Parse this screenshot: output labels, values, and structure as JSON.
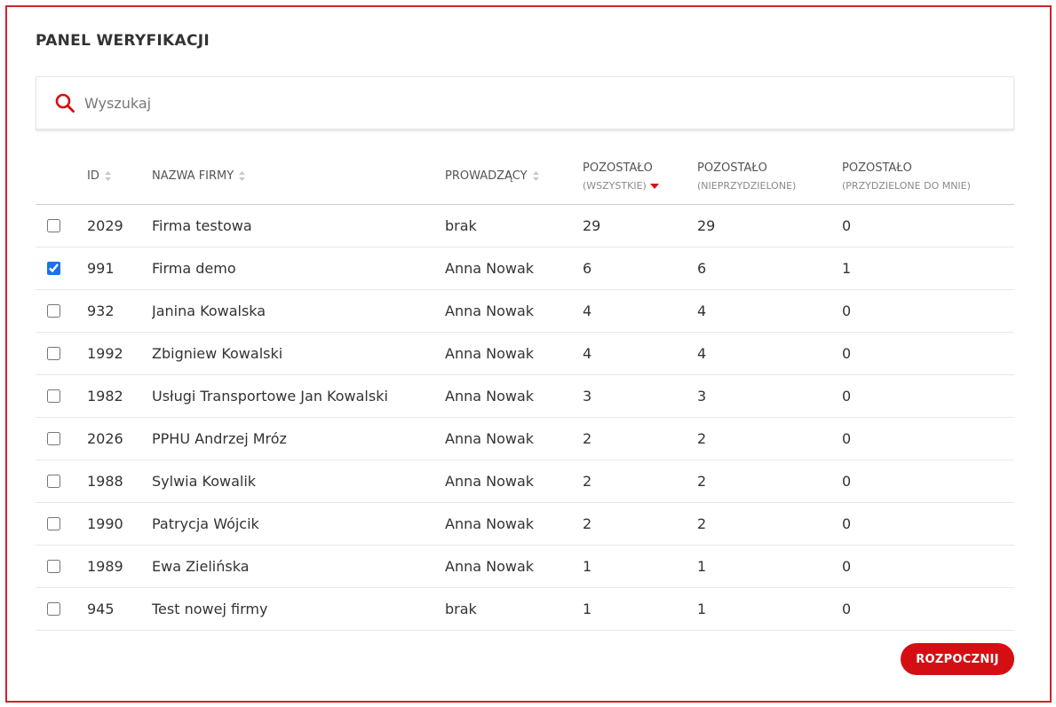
{
  "panel": {
    "title": "PANEL WERYFIKACJI"
  },
  "search": {
    "placeholder": "Wyszukaj",
    "value": "",
    "icon": "search-icon"
  },
  "table": {
    "headers": {
      "id": "ID",
      "company": "NAZWA FIRMY",
      "manager": "PROWADZĄCY",
      "remaining_all": {
        "label": "POZOSTAŁO",
        "sub": "(WSZYSTKIE)"
      },
      "remaining_unassigned": {
        "label": "POZOSTAŁO",
        "sub": "(NIEPRZYDZIELONE)"
      },
      "remaining_mine": {
        "label": "POZOSTAŁO",
        "sub": "(PRZYDZIELONE DO MNIE)"
      }
    },
    "sort": {
      "column": "remaining_all",
      "direction": "desc"
    },
    "rows": [
      {
        "checked": false,
        "id": "2029",
        "company": "Firma testowa",
        "manager": "brak",
        "all": "29",
        "unassigned": "29",
        "mine": "0"
      },
      {
        "checked": true,
        "id": "991",
        "company": "Firma demo",
        "manager": "Anna Nowak",
        "all": "6",
        "unassigned": "6",
        "mine": "1"
      },
      {
        "checked": false,
        "id": "932",
        "company": "Janina Kowalska",
        "manager": "Anna Nowak",
        "all": "4",
        "unassigned": "4",
        "mine": "0"
      },
      {
        "checked": false,
        "id": "1992",
        "company": "Zbigniew Kowalski",
        "manager": "Anna Nowak",
        "all": "4",
        "unassigned": "4",
        "mine": "0"
      },
      {
        "checked": false,
        "id": "1982",
        "company": "Usługi Transportowe Jan Kowalski",
        "manager": "Anna Nowak",
        "all": "3",
        "unassigned": "3",
        "mine": "0"
      },
      {
        "checked": false,
        "id": "2026",
        "company": "PPHU Andrzej Mróz",
        "manager": "Anna Nowak",
        "all": "2",
        "unassigned": "2",
        "mine": "0"
      },
      {
        "checked": false,
        "id": "1988",
        "company": "Sylwia Kowalik",
        "manager": "Anna Nowak",
        "all": "2",
        "unassigned": "2",
        "mine": "0"
      },
      {
        "checked": false,
        "id": "1990",
        "company": "Patrycja Wójcik",
        "manager": "Anna Nowak",
        "all": "2",
        "unassigned": "2",
        "mine": "0"
      },
      {
        "checked": false,
        "id": "1989",
        "company": "Ewa Zielińska",
        "manager": "Anna Nowak",
        "all": "1",
        "unassigned": "1",
        "mine": "0"
      },
      {
        "checked": false,
        "id": "945",
        "company": "Test nowej firmy",
        "manager": "brak",
        "all": "1",
        "unassigned": "1",
        "mine": "0"
      }
    ]
  },
  "actions": {
    "start_label": "ROZPOCZNIJ"
  },
  "colors": {
    "accent": "#d40f14",
    "frame_border": "#d0232b",
    "checkbox": "#1a73e8"
  }
}
